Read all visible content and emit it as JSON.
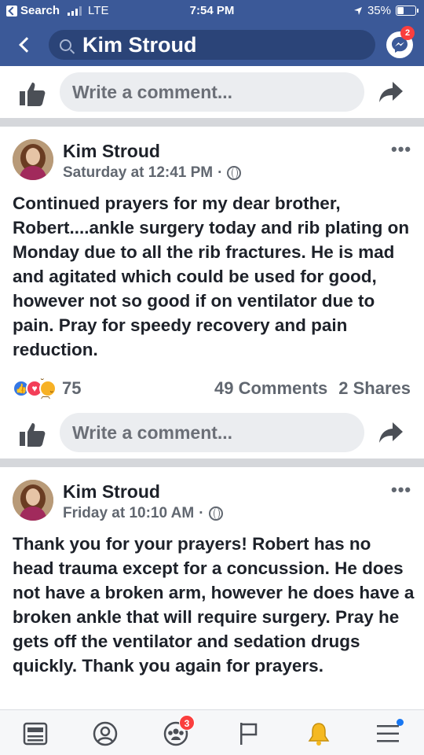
{
  "status_bar": {
    "back_app": "Search",
    "carrier": "LTE",
    "time": "7:54 PM",
    "battery": "35%"
  },
  "nav": {
    "search_query": "Kim Stroud",
    "messenger_badge": "2"
  },
  "comment_bar": {
    "placeholder": "Write a comment..."
  },
  "posts": [
    {
      "author": "Kim Stroud",
      "timestamp": "Saturday at 12:41 PM",
      "more": "•••",
      "text": "Continued prayers for my dear brother, Robert....ankle surgery today and rib plating on Monday due to all the rib fractures.  He is mad and agitated which could be used for good, however not so good if on ventilator due to pain.  Pray for speedy recovery and pain reduction.",
      "reaction_count": "75",
      "comments": "49 Comments",
      "shares": "2 Shares"
    },
    {
      "author": "Kim Stroud",
      "timestamp": "Friday at 10:10 AM",
      "more": "•••",
      "text": "Thank you for your prayers! Robert has no head trauma except for a concussion. He does not have a broken arm, however he does have a broken ankle that will require surgery. Pray he gets off the ventilator and sedation drugs quickly.  Thank you again for prayers."
    }
  ],
  "tabbar": {
    "groups_badge": "3"
  },
  "colors": {
    "header": "#3b5998",
    "badge": "#fa3e3e",
    "like_blue": "#3578e5",
    "love_red": "#f33e58",
    "sad_yellow": "#f7b125"
  }
}
